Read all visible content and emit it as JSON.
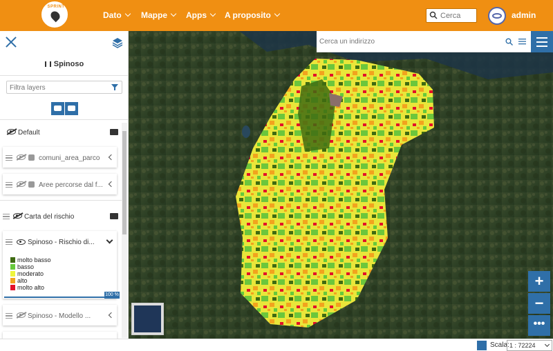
{
  "header": {
    "logo_text": "SPRINT",
    "nav": [
      {
        "label": "Dato"
      },
      {
        "label": "Mappe"
      },
      {
        "label": "Apps"
      },
      {
        "label": "A proposito"
      }
    ],
    "search_placeholder": "Cerca",
    "user": "admin"
  },
  "panel": {
    "title": "Spinoso",
    "filter_placeholder": "Filtra layers",
    "groups": [
      {
        "label": "Default",
        "layers": [
          {
            "label": "comuni_area_parco"
          },
          {
            "label": "Aree percorse dal f..."
          }
        ]
      },
      {
        "label": "Carta del rischio",
        "layers": [
          {
            "label": "Spinoso - Rischio di..."
          },
          {
            "label": "Spinoso - Modello ..."
          }
        ]
      }
    ],
    "legend": [
      {
        "label": "molto basso",
        "color": "#3f6b12"
      },
      {
        "label": "basso",
        "color": "#67c93b"
      },
      {
        "label": "moderato",
        "color": "#eef53c"
      },
      {
        "label": "alto",
        "color": "#f2a31e"
      },
      {
        "label": "molto alto",
        "color": "#e3102a"
      }
    ],
    "opacity": "100 %"
  },
  "map": {
    "address_placeholder": "Cerca un indirizzo",
    "scale_label": "Scala:",
    "scale_value": "1 : 72224"
  },
  "colors": {
    "header": "#f08f12",
    "accent": "#2f6fa8"
  }
}
